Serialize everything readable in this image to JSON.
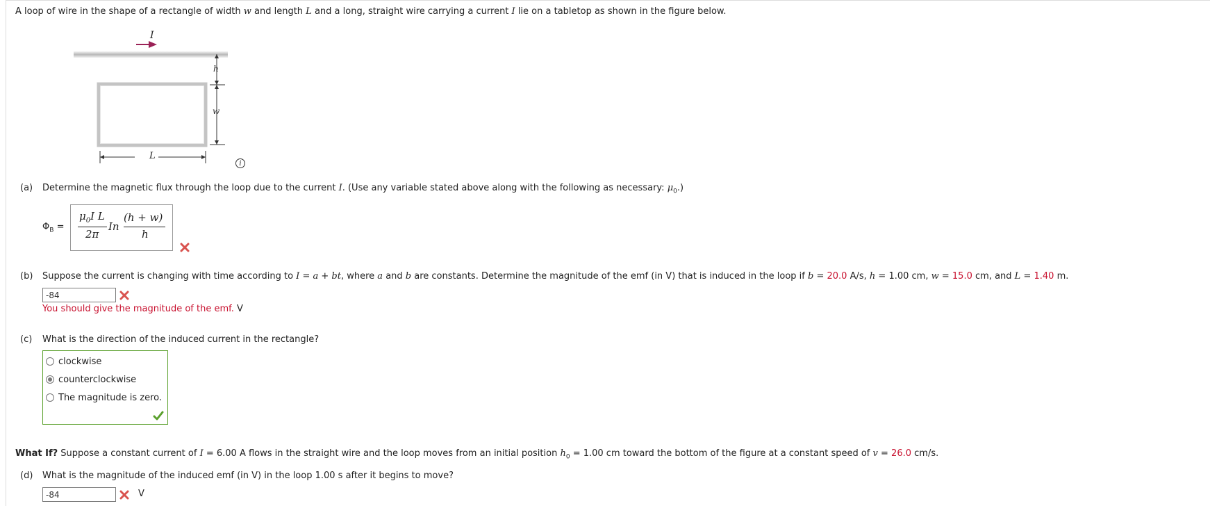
{
  "intro": {
    "p1": "A loop of wire in the shape of a rectangle of width ",
    "w": "w",
    "p2": " and length ",
    "L": "L",
    "p3": " and a long, straight wire carrying a current ",
    "I": "I",
    "p4": " lie on a tabletop as shown in the figure below."
  },
  "figure": {
    "current_label": "I",
    "h_label": "h",
    "w_label": "w",
    "L_label": "L",
    "wire_arrow_color": "#9b2257",
    "info_icon": "info-icon",
    "info_glyph": "i"
  },
  "part_a": {
    "label": "(a)",
    "text1": "Determine the magnetic flux through the loop due to the current ",
    "I": "I",
    "text2": ". (Use any variable stated above along with the following as necessary: ",
    "mu": "μ",
    "mu_sub": "0",
    "text3": ".)",
    "phi_label": "Φ",
    "phi_sub": "B",
    "equals": "=",
    "answer": {
      "num1": "μ",
      "num1_sub": "0",
      "num1_rest": "I L",
      "den1": "2π",
      "ln": "In",
      "num2": "(h + w)",
      "den2": "h"
    },
    "status_icon": "x-icon"
  },
  "part_b": {
    "label": "(b)",
    "t1": "Suppose the current is changing with time according to ",
    "I": "I",
    "t2": " = ",
    "a": "a",
    "t3": " + ",
    "bt": "bt",
    "t4": ", where ",
    "a2": "a",
    "t5": " and ",
    "b": "b",
    "t6": " are constants. Determine the magnitude of the emf (in V) that is induced in the loop if ",
    "b2": "b",
    "t7": " = ",
    "b_val": "20.0",
    "t8": " A/s, ",
    "h": "h",
    "t9": " = 1.00 cm, ",
    "w": "w",
    "t10": " = ",
    "w_val": "15.0",
    "t11": " cm, and ",
    "L": "L",
    "t12": " = ",
    "L_val": "1.40",
    "t13": " m.",
    "input_value": "-84",
    "feedback": "You should give the magnitude of the emf.",
    "unit": "V",
    "status_icon": "x-icon"
  },
  "part_c": {
    "label": "(c)",
    "question": "What is the direction of the induced current in the rectangle?",
    "options": [
      "clockwise",
      "counterclockwise",
      "The magnitude is zero."
    ],
    "selected_index": 1,
    "status_icon": "check-icon"
  },
  "what_if": {
    "bold": "What If?",
    "t1": " Suppose a constant current of ",
    "I": "I",
    "t2": " = 6.00 A flows in the straight wire and the loop moves from an initial position ",
    "h0": "h",
    "h0_sub": "0",
    "t3": " = 1.00 cm toward the bottom of the figure at a constant speed of ",
    "v": "v",
    "t4": " = ",
    "v_val": "26.0",
    "t5": " cm/s."
  },
  "part_d": {
    "label": "(d)",
    "question": "What is the magnitude of the induced emf (in V) in the loop 1.00 s after it begins to move?",
    "input_value": "-84",
    "unit": "V",
    "status_icon": "x-icon"
  },
  "colors": {
    "red": "#c8102e",
    "green": "#5aa02c",
    "x": "#d9534f"
  }
}
